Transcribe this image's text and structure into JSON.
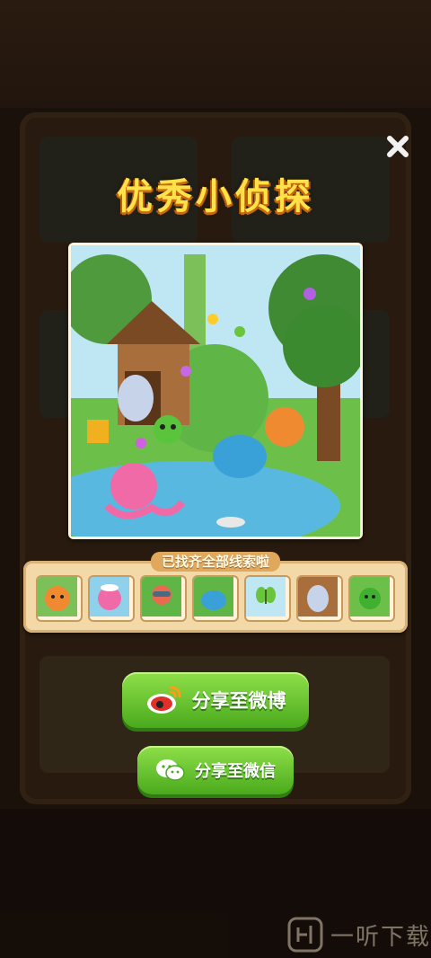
{
  "title": "优秀小侦探",
  "clue_strip": {
    "label": "已找齐全部线索啦",
    "clues": [
      "fox",
      "octopus",
      "bird-in-goggles",
      "blue-creature",
      "butterfly",
      "yeti",
      "green-blob"
    ]
  },
  "buttons": {
    "weibo": "分享至微博",
    "wechat": "分享至微信"
  },
  "watermark": "一听下载",
  "icons": {
    "close": "close-icon",
    "weibo": "weibo-icon",
    "wechat": "wechat-icon"
  },
  "colors": {
    "title": "#ffe14a",
    "button_green": "#5cc026",
    "strip": "#f4d9a8"
  }
}
